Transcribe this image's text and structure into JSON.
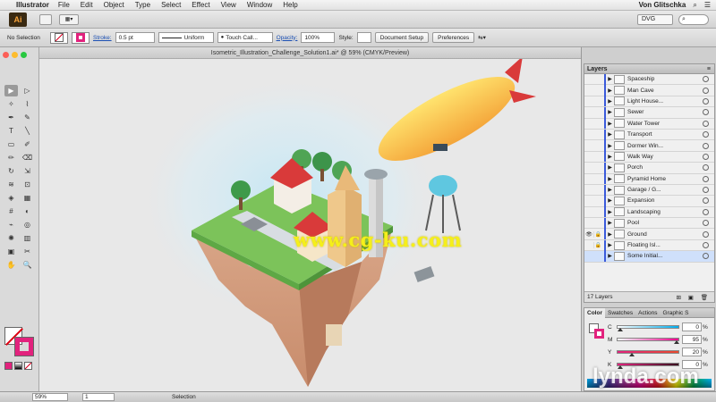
{
  "menubar": {
    "apple": "",
    "app_name": "Illustrator",
    "items": [
      "File",
      "Edit",
      "Object",
      "Type",
      "Select",
      "Effect",
      "View",
      "Window",
      "Help"
    ],
    "user": "Von Glitschka"
  },
  "appbar": {
    "logo": "Ai",
    "workspace": "DVG",
    "search_placeholder": ""
  },
  "controlbar": {
    "selection_status": "No Selection",
    "stroke_label": "Stroke:",
    "stroke_weight": "0.5 pt",
    "stroke_style": "Uniform",
    "brush": "Touch Call...",
    "opacity_label": "Opacity:",
    "opacity": "100%",
    "style_label": "Style:",
    "document_setup": "Document Setup",
    "preferences": "Preferences"
  },
  "document": {
    "tab_title": "Isometric_Illustration_Challenge_Solution1.ai* @ 59% (CMYK/Preview)"
  },
  "tools": [
    {
      "glyph": "▶",
      "name": "selection-tool-icon",
      "active": true
    },
    {
      "glyph": "▷",
      "name": "direct-selection-tool-icon"
    },
    {
      "glyph": "✧",
      "name": "magic-wand-tool-icon"
    },
    {
      "glyph": "⌇",
      "name": "lasso-tool-icon"
    },
    {
      "glyph": "✒",
      "name": "pen-tool-icon"
    },
    {
      "glyph": "✎",
      "name": "curvature-tool-icon"
    },
    {
      "glyph": "T",
      "name": "type-tool-icon"
    },
    {
      "glyph": "╲",
      "name": "line-segment-tool-icon"
    },
    {
      "glyph": "▭",
      "name": "rectangle-tool-icon"
    },
    {
      "glyph": "✐",
      "name": "paintbrush-tool-icon"
    },
    {
      "glyph": "✏",
      "name": "pencil-tool-icon"
    },
    {
      "glyph": "⌫",
      "name": "eraser-tool-icon"
    },
    {
      "glyph": "↻",
      "name": "rotate-tool-icon"
    },
    {
      "glyph": "⇲",
      "name": "scale-tool-icon"
    },
    {
      "glyph": "≋",
      "name": "width-tool-icon"
    },
    {
      "glyph": "⊡",
      "name": "free-transform-tool-icon"
    },
    {
      "glyph": "◈",
      "name": "shape-builder-tool-icon"
    },
    {
      "glyph": "▦",
      "name": "perspective-grid-tool-icon"
    },
    {
      "glyph": "#",
      "name": "mesh-tool-icon"
    },
    {
      "glyph": "◐",
      "name": "gradient-tool-icon"
    },
    {
      "glyph": "⌁",
      "name": "eyedropper-tool-icon"
    },
    {
      "glyph": "◎",
      "name": "blend-tool-icon"
    },
    {
      "glyph": "✺",
      "name": "symbol-sprayer-tool-icon"
    },
    {
      "glyph": "▥",
      "name": "column-graph-tool-icon"
    },
    {
      "glyph": "▣",
      "name": "artboard-tool-icon"
    },
    {
      "glyph": "✂",
      "name": "slice-tool-icon"
    },
    {
      "glyph": "✋",
      "name": "hand-tool-icon"
    },
    {
      "glyph": "🔍",
      "name": "zoom-tool-icon"
    }
  ],
  "layers": {
    "title": "Layers",
    "items": [
      {
        "name": "Spaceship",
        "visible": false,
        "locked": false
      },
      {
        "name": "Man Cave",
        "visible": false,
        "locked": false
      },
      {
        "name": "Light House...",
        "visible": false,
        "locked": false
      },
      {
        "name": "Sewer",
        "visible": false,
        "locked": false
      },
      {
        "name": "Water Tower",
        "visible": false,
        "locked": false
      },
      {
        "name": "Transport",
        "visible": false,
        "locked": false
      },
      {
        "name": "Dormer Win...",
        "visible": false,
        "locked": false
      },
      {
        "name": "Walk Way",
        "visible": false,
        "locked": false
      },
      {
        "name": "Porch",
        "visible": false,
        "locked": false
      },
      {
        "name": "Pyramid Home",
        "visible": false,
        "locked": false
      },
      {
        "name": "Garage / G...",
        "visible": false,
        "locked": false
      },
      {
        "name": "Expansion",
        "visible": false,
        "locked": false
      },
      {
        "name": "Landscaping",
        "visible": false,
        "locked": false
      },
      {
        "name": "Pool",
        "visible": false,
        "locked": false
      },
      {
        "name": "Ground",
        "visible": true,
        "locked": true
      },
      {
        "name": "Floating Isl...",
        "visible": false,
        "locked": true
      },
      {
        "name": "Some Initial...",
        "visible": false,
        "locked": false,
        "selected": true
      }
    ],
    "count_label": "17 Layers"
  },
  "color_panel": {
    "tabs": [
      "Color",
      "Swatches",
      "Actions",
      "Graphic S"
    ],
    "active_tab": "Color",
    "cmyk": [
      {
        "label": "C",
        "value": "0",
        "fraction": 0.0,
        "gradient": "linear-gradient(to right,#fff,#00aeef)"
      },
      {
        "label": "M",
        "value": "95",
        "fraction": 0.95,
        "gradient": "linear-gradient(to right,#fff,#ec008c)"
      },
      {
        "label": "Y",
        "value": "20",
        "fraction": 0.2,
        "gradient": "linear-gradient(to right,#e2227d,#e84a2e)"
      },
      {
        "label": "K",
        "value": "0",
        "fraction": 0.0,
        "gradient": "linear-gradient(to right,#e2227d,#3a1020)"
      }
    ],
    "percent": "%"
  },
  "statusbar": {
    "zoom": "59%",
    "artboard": "1",
    "status": "Selection"
  },
  "watermarks": {
    "cg": "www.cg-ku.com",
    "lynda": "lynda.com"
  },
  "colors": {
    "accent_pink": "#e2227d",
    "layer_color": "#3b5bdb",
    "selection_bg": "#cfe0fb"
  }
}
